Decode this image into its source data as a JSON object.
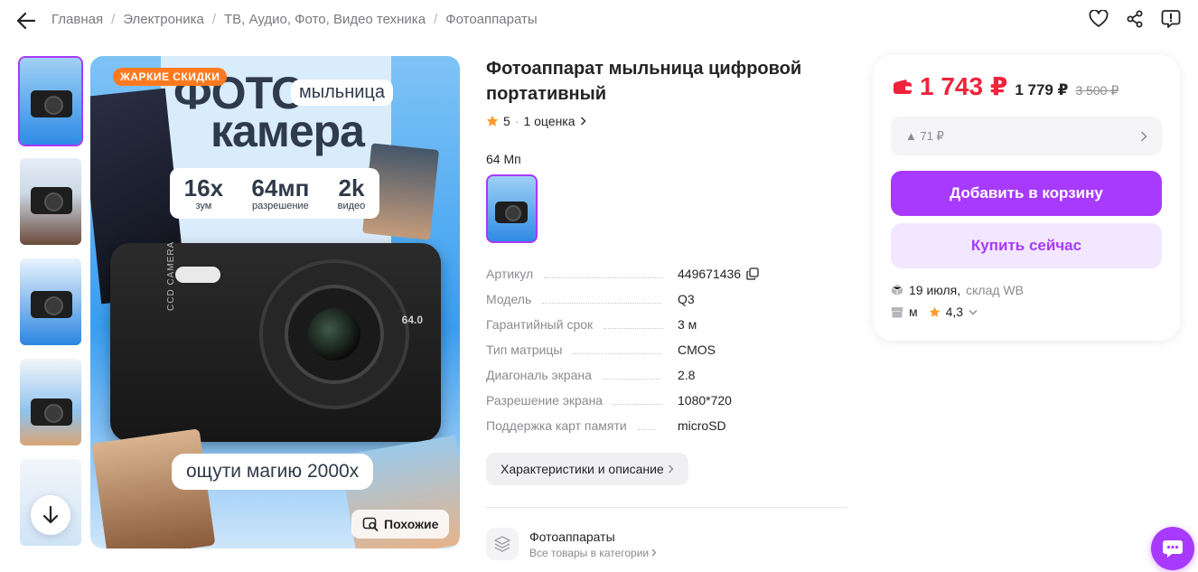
{
  "breadcrumbs": [
    "Главная",
    "Электроника",
    "ТВ, Аудио, Фото, Видео техника",
    "Фотоаппараты"
  ],
  "icons": {
    "back": "arrow-left-icon",
    "favorite": "heart-icon",
    "share": "share-icon",
    "report": "report-icon",
    "scroll_down": "arrow-down-icon",
    "similar": "image-search-icon",
    "copy": "copy-icon",
    "wallet": "wallet-icon",
    "delivery": "box-icon",
    "shop": "shop-icon",
    "star": "star-icon",
    "category": "layers-icon",
    "chat": "chat-icon"
  },
  "colors": {
    "accent": "#a73afd",
    "price": "#f0233c",
    "sale_badge": "#ff7a1f",
    "star": "#ff9a2e"
  },
  "gallery": {
    "badge": "ЖАРКИЕ СКИДКИ",
    "similar_label": "Похожие",
    "image_text": {
      "title_line1": "ФОТО",
      "title_line2": "камера",
      "pill": "мыльница",
      "stats": [
        {
          "big": "16x",
          "small": "зум"
        },
        {
          "big": "64мп",
          "small": "разрешение"
        },
        {
          "big": "2k",
          "small": "видео"
        }
      ],
      "slogan": "ощути магию 2000х",
      "camera_side": "CCD CAMERA",
      "camera_mp": "64.0"
    }
  },
  "product": {
    "title": "Фотоаппарат мыльница цифровой портативный",
    "rating": "5",
    "reviews": "1 оценка",
    "variant_label": "64 Мп",
    "specs": [
      {
        "key": "Артикул",
        "value": "449671436"
      },
      {
        "key": "Модель",
        "value": "Q3"
      },
      {
        "key": "Гарантийный срок",
        "value": "3 м"
      },
      {
        "key": "Тип матрицы",
        "value": "CMOS"
      },
      {
        "key": "Диагональ экрана",
        "value": "2.8"
      },
      {
        "key": "Разрешение экрана",
        "value": "1080*720"
      },
      {
        "key": "Поддержка карт памяти",
        "value": "microSD"
      }
    ],
    "details_button": "Характеристики и описание",
    "category": {
      "name": "Фотоаппараты",
      "link": "Все товары в категории"
    }
  },
  "buy_box": {
    "price": "1 743 ₽",
    "price_wb": "1 779 ₽",
    "price_old": "3 500 ₽",
    "discount": "▲ 71 ₽",
    "add_to_cart": "Добавить в корзину",
    "buy_now": "Купить сейчас",
    "delivery_date": "19 июля",
    "warehouse": "склад WB",
    "seller": "м",
    "seller_rating": "4,3"
  }
}
